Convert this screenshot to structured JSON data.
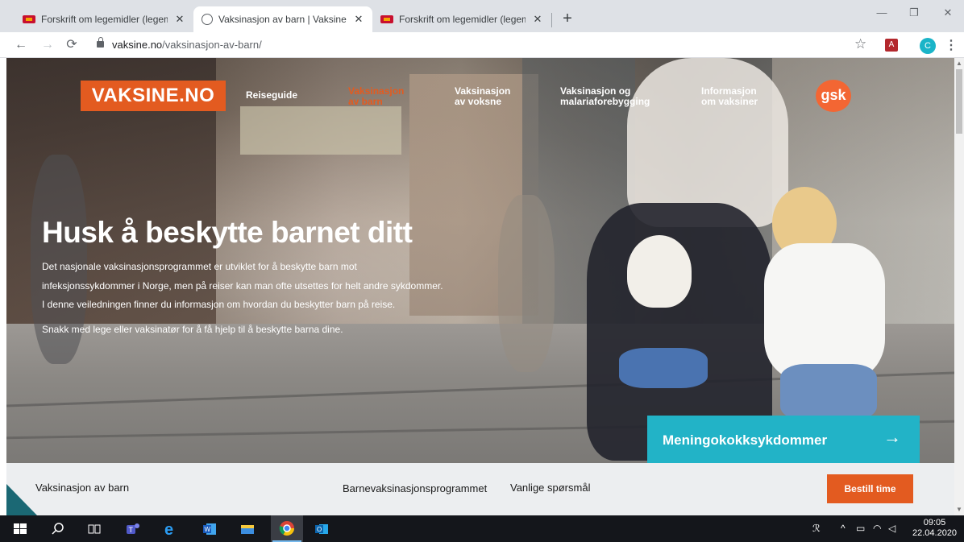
{
  "browser": {
    "tabs": [
      {
        "title": "Forskrift om legemidler (legemid",
        "active": false,
        "favicon": "lovdata-icon"
      },
      {
        "title": "Vaksinasjon av barn | Vaksine.no",
        "active": true,
        "favicon": "globe-icon"
      },
      {
        "title": "Forskrift om legemidler (legemid",
        "active": false,
        "favicon": "lovdata-icon"
      }
    ],
    "new_tab": "+",
    "window_controls": {
      "minimize": "—",
      "restore": "❐",
      "close": "✕"
    },
    "url_host": "vaksine.no",
    "url_path": "/vaksinasjon-av-barn/",
    "profile_initial": "C",
    "pdf_ext": "A"
  },
  "site": {
    "logo": "VAKSINE.NO",
    "nav": {
      "reiseguide": "Reiseguide",
      "barn_1": "Vaksinasjon",
      "barn_2": "av barn",
      "voksne_1": "Vaksinasjon",
      "voksne_2": "av voksne",
      "malaria_1": "Vaksinasjon og",
      "malaria_2": "malariaforebygging",
      "info_1": "Informasjon",
      "info_2": "om vaksiner"
    },
    "sponsor": "gsk",
    "headline": "Husk å beskytte barnet ditt",
    "body": [
      "Det nasjonale vaksinasjonsprogrammet er utviklet for å beskytte barn mot",
      "infeksjonssykdommer i Norge, men på reiser kan man ofte utsettes for helt andre sykdommer.",
      "I denne veiledningen finner du informasjon om hvordan du beskytter barn på reise.",
      "Snakk med lege eller vaksinatør for å få hjelp til å beskytte barna dine."
    ],
    "cta": {
      "label": "Meningokokksykdommer",
      "arrow": "→"
    },
    "subnav": {
      "title": "Vaksinasjon av barn",
      "link1": "Barnevaksinasjonsprogrammet",
      "link2": "Vanlige spørsmål",
      "button": "Bestill time"
    },
    "colors": {
      "brand_orange": "#e35b20",
      "cta_teal": "#22b3c7",
      "corner_teal": "#1b6874"
    }
  },
  "taskbar": {
    "time": "09:05",
    "date": "22.04.2020"
  }
}
